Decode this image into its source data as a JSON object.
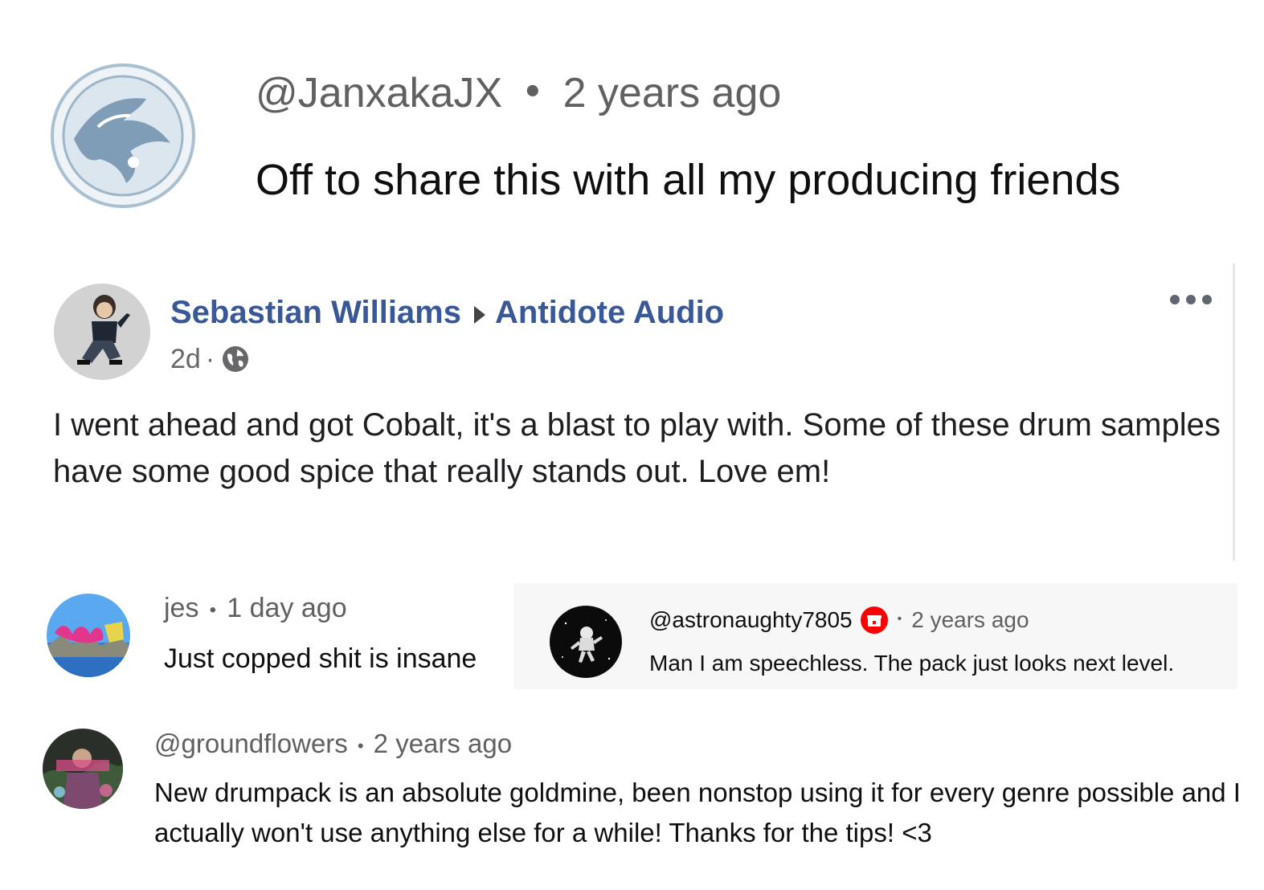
{
  "comment_1": {
    "author": "@JanxakaJX",
    "separator": "•",
    "time": "2 years ago",
    "text": "Off to share this with all my producing friends",
    "avatar_icon": "circular-seal-avatar"
  },
  "facebook_post": {
    "author": "Sebastian Williams",
    "page": "Antidote Audio",
    "time": "2d",
    "time_separator": "·",
    "privacy_icon": "globe-icon",
    "more_icon": "more-options-icon",
    "text": "I went ahead and got Cobalt, it's a blast to play with. Some of these drum samples have some good spice that really stands out. Love em!",
    "link_color": "#385898"
  },
  "comment_jes": {
    "author": "jes",
    "separator": "•",
    "time": "1 day ago",
    "text": "Just copped shit is insane"
  },
  "comment_astro": {
    "author": "@astronaughty7805",
    "badge_icon": "red-gift-badge-icon",
    "separator": "•",
    "time": "2 years ago",
    "text": "Man I am speechless. The pack just looks next level."
  },
  "comment_groundflowers": {
    "author": "@groundflowers",
    "separator": "•",
    "time": "2 years ago",
    "text": "New drumpack is an absolute goldmine, been nonstop using it for every genre possible and I actually won't use anything else for a while! Thanks for the tips! <3"
  }
}
